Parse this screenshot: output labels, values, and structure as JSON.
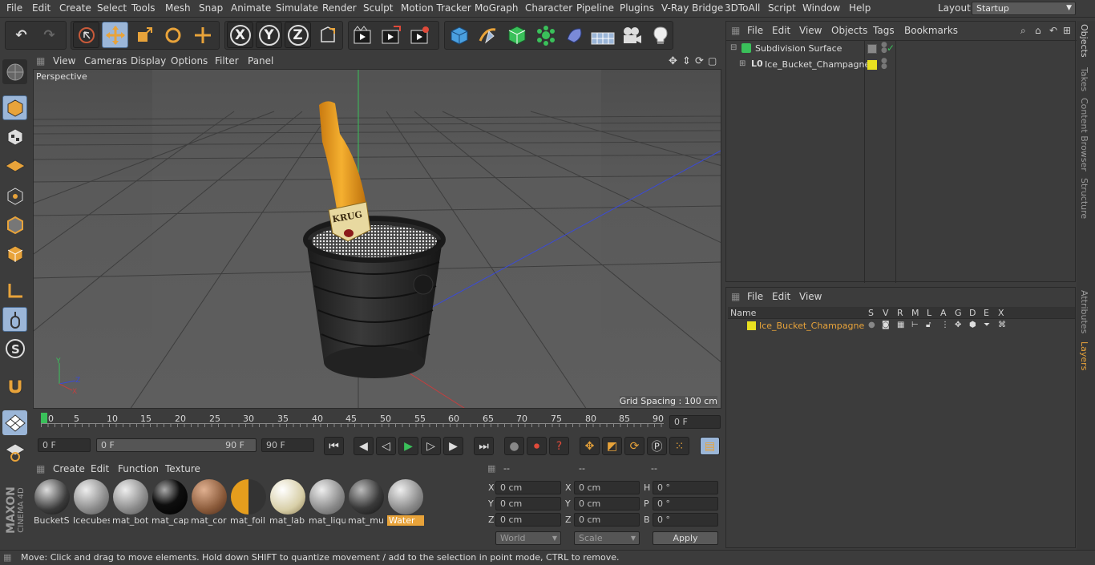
{
  "menu": [
    "File",
    "Edit",
    "Create",
    "Select",
    "Tools",
    "Mesh",
    "Snap",
    "Animate",
    "Simulate",
    "Render",
    "Sculpt",
    "Motion Tracker",
    "MoGraph",
    "Character",
    "Pipeline",
    "Plugins",
    "V-Ray Bridge",
    "3DToAll",
    "Script",
    "Window",
    "Help"
  ],
  "layout": {
    "label": "Layout:",
    "value": "Startup"
  },
  "axis_buttons": {
    "x": "X",
    "y": "Y",
    "z": "Z"
  },
  "viewport": {
    "menu": [
      "View",
      "Cameras",
      "Display",
      "Options",
      "Filter",
      "Panel"
    ],
    "title": "Perspective",
    "grid_spacing": "Grid Spacing : 100 cm",
    "label_text": "KRUG"
  },
  "timeline": {
    "ticks": [
      "0",
      "5",
      "10",
      "15",
      "20",
      "25",
      "30",
      "35",
      "40",
      "45",
      "50",
      "55",
      "60",
      "65",
      "70",
      "75",
      "80",
      "85",
      "90"
    ],
    "current_frame": "0 F"
  },
  "transport": {
    "start": "0 F",
    "range_start": "0 F",
    "range_end": "90 F",
    "end": "90 F"
  },
  "materials": {
    "menu": [
      "Create",
      "Edit",
      "Function",
      "Texture"
    ],
    "items": [
      {
        "label": "BucketS",
        "color": "#3a3a3a"
      },
      {
        "label": "Icecubes",
        "color": "#8a8a8a"
      },
      {
        "label": "mat_bot",
        "color": "#8a8a8a"
      },
      {
        "label": "mat_cap",
        "color": "#0e0e0e"
      },
      {
        "label": "mat_cor",
        "color": "#8a5a3a"
      },
      {
        "label": "mat_foil",
        "color": "#e59d1d"
      },
      {
        "label": "mat_lab",
        "color": "#d8cfa8"
      },
      {
        "label": "mat_liqu",
        "color": "#8a8a8a"
      },
      {
        "label": "mat_mu",
        "color": "#3a3a3a"
      },
      {
        "label": "Water",
        "color": "#8a8a8a"
      }
    ]
  },
  "coords": {
    "headers": [
      "--",
      "--",
      "--"
    ],
    "rows": [
      {
        "a": "X",
        "av": "0 cm",
        "b": "X",
        "bv": "0 cm",
        "c": "H",
        "cv": "0 °"
      },
      {
        "a": "Y",
        "av": "0 cm",
        "b": "Y",
        "bv": "0 cm",
        "c": "P",
        "cv": "0 °"
      },
      {
        "a": "Z",
        "av": "0 cm",
        "b": "Z",
        "bv": "0 cm",
        "c": "B",
        "cv": "0 °"
      }
    ],
    "space": "World",
    "mode": "Scale",
    "apply": "Apply"
  },
  "objects": {
    "menu": [
      "File",
      "Edit",
      "View",
      "Objects",
      "Tags",
      "Bookmarks"
    ],
    "items": [
      {
        "name": "Subdivision Surface"
      },
      {
        "name": "Ice_Bucket_Champagne"
      }
    ]
  },
  "layers": {
    "menu": [
      "File",
      "Edit",
      "View"
    ],
    "columns": [
      "Name",
      "S",
      "V",
      "R",
      "M",
      "L",
      "A",
      "G",
      "D",
      "E",
      "X"
    ],
    "row": "Ice_Bucket_Champagne"
  },
  "sidetabs": [
    "Objects",
    "Takes",
    "Content Browser",
    "Structure",
    "Attributes",
    "Layers"
  ],
  "status": "Move: Click and drag to move elements. Hold down SHIFT to quantize movement / add to the selection in point mode, CTRL to remove.",
  "brand": {
    "line1": "MAXON",
    "line2": "CINEMA 4D"
  },
  "colors": {
    "accent": "#e8a33a",
    "active_blue": "#9bb6d8",
    "layer_yellow": "#e8e020"
  }
}
